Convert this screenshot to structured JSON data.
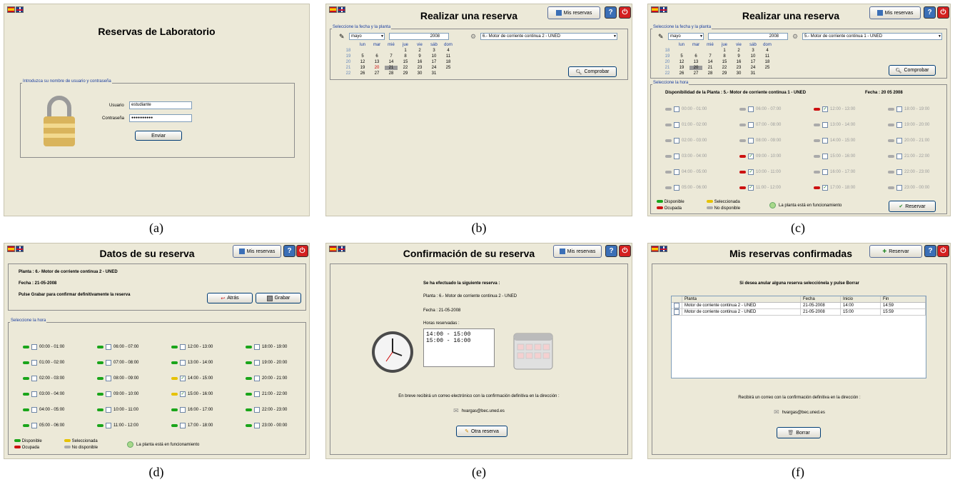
{
  "captions": {
    "a": "(a)",
    "b": "(b)",
    "c": "(c)",
    "d": "(d)",
    "e": "(e)",
    "f": "(f)"
  },
  "a": {
    "title": "Reservas de Laboratorio",
    "group_label": "Introduzca su nombre de usuario y contraseña",
    "user_label": "Usuario",
    "user_value": "estudiante",
    "pass_label": "Contraseña",
    "pass_value": "●●●●●●●●●●",
    "submit": "Enviar"
  },
  "b": {
    "title": "Realizar una reserva",
    "my_reservations": "Mis reservas",
    "group_label": "Seleccione la fecha y la planta",
    "month": "mayo",
    "year": "2008",
    "plant": "6.- Motor de corriente continua 2 - UNED",
    "check": "Comprobar"
  },
  "calendar": {
    "headers": [
      "lun",
      "mar",
      "mié",
      "jue",
      "vie",
      "sáb",
      "dom"
    ],
    "weeks": [
      {
        "wk": "18",
        "days": [
          "",
          "",
          "",
          "1",
          "2",
          "3",
          "4"
        ]
      },
      {
        "wk": "19",
        "days": [
          "5",
          "6",
          "7",
          "8",
          "9",
          "10",
          "11"
        ]
      },
      {
        "wk": "20",
        "days": [
          "12",
          "13",
          "14",
          "15",
          "16",
          "17",
          "18"
        ]
      },
      {
        "wk": "21",
        "days": [
          "19",
          "20",
          "21",
          "22",
          "23",
          "24",
          "25"
        ]
      },
      {
        "wk": "22",
        "days": [
          "26",
          "27",
          "28",
          "29",
          "30",
          "31",
          ""
        ]
      }
    ]
  },
  "c": {
    "title": "Realizar una reserva",
    "my_reservations": "Mis reservas",
    "group_label": "Seleccione la fecha y la planta",
    "month": "mayo",
    "year": "2008",
    "plant": "5.- Motor de corriente continua 1 - UNED",
    "check": "Comprobar",
    "hour_label": "Seleccione la hora",
    "availability": "Disponibilidad de la Planta : 5.- Motor de corriente continua 1 - UNED",
    "date": "Fecha : 20 05 2008",
    "slots": [
      [
        "00:00 - 01:00",
        "01:00 - 02:00",
        "02:00 - 03:00",
        "03:00 - 04:00",
        "04:00 - 05:00",
        "05:00 - 06:00"
      ],
      [
        "06:00 - 07:00",
        "07:00 - 08:00",
        "08:00 - 09:00",
        "09:00 - 10:00",
        "10:00 - 11:00",
        "11:00 - 12:00"
      ],
      [
        "12:00 - 13:00",
        "13:00 - 14:00",
        "14:00 - 15:00",
        "15:00 - 16:00",
        "16:00 - 17:00",
        "17:00 - 18:00"
      ],
      [
        "18:00 - 19:00",
        "19:00 - 20:00",
        "20:00 - 21:00",
        "21:00 - 22:00",
        "22:00 - 23:00",
        "23:00 - 00:00"
      ]
    ],
    "legend": {
      "available": "Disponible",
      "occupied": "Ocupada",
      "selected": "Seleccionada",
      "unavailable": "No disponible",
      "running": "La planta está en funcionamiento"
    },
    "reserve": "Reservar"
  },
  "d": {
    "title": "Datos de su reserva",
    "my_reservations": "Mis reservas",
    "plant": "Planta : 6.- Motor de corriente continua 2 - UNED",
    "date": "Fecha : 21-05-2008",
    "instruction": "Pulse Grabar para confirmar definitivamente la reserva",
    "back": "Atrás",
    "save": "Grabar",
    "hour_label": "Seleccione la hora",
    "slots": [
      [
        "00:00 - 01:00",
        "01:00 - 02:00",
        "02:00 - 03:00",
        "03:00 - 04:00",
        "04:00 - 05:00",
        "05:00 - 06:00"
      ],
      [
        "06:00 - 07:00",
        "07:00 - 08:00",
        "08:00 - 09:00",
        "09:00 - 10:00",
        "10:00 - 11:00",
        "11:00 - 12:00"
      ],
      [
        "12:00 - 13:00",
        "13:00 - 14:00",
        "14:00 - 15:00",
        "15:00 - 16:00",
        "16:00 - 17:00",
        "17:00 - 18:00"
      ],
      [
        "18:00 - 19:00",
        "19:00 - 20:00",
        "20:00 - 21:00",
        "21:00 - 22:00",
        "22:00 - 23:00",
        "23:00 - 00:00"
      ]
    ],
    "legend": {
      "available": "Disponible",
      "occupied": "Ocupada",
      "selected": "Seleccionada",
      "unavailable": "No disponible",
      "running": "La planta está en funcionamiento"
    }
  },
  "e": {
    "title": "Confirmación de su reserva",
    "my_reservations": "Mis reservas",
    "heading": "Se ha efectuado la siguiente reserva :",
    "plant": "Planta : 6.- Motor de corriente continua 2 - UNED",
    "date": "Fecha : 21-05-2008",
    "hours_label": "Horas reservadas :",
    "hour1": "14:00 - 15:00",
    "hour2": "15:00 - 16:00",
    "email_note": "En breve recibirá un correo electrónico con la confirmación definitiva en la dirección :",
    "email": "hvargas@bec.uned.es",
    "another": "Otra reserva"
  },
  "f": {
    "title": "Mis reservas confirmadas",
    "reserve": "Reservar",
    "instruction": "Si desea anular alguna reserva selecciónela y pulse Borrar",
    "columns": [
      "Planta",
      "Fecha",
      "Inicio",
      "Fin"
    ],
    "rows": [
      [
        "Motor de corriente continua 2 - UNED",
        "21-05-2008",
        "14:00",
        "14:59"
      ],
      [
        "Motor de corriente continua 2 - UNED",
        "21-05-2008",
        "15:00",
        "15:59"
      ]
    ],
    "email_note": "Recibirá un correo con la confirmación definitiva en la dirección :",
    "email": "hvargas@bec.uned.es",
    "delete": "Borrar"
  }
}
